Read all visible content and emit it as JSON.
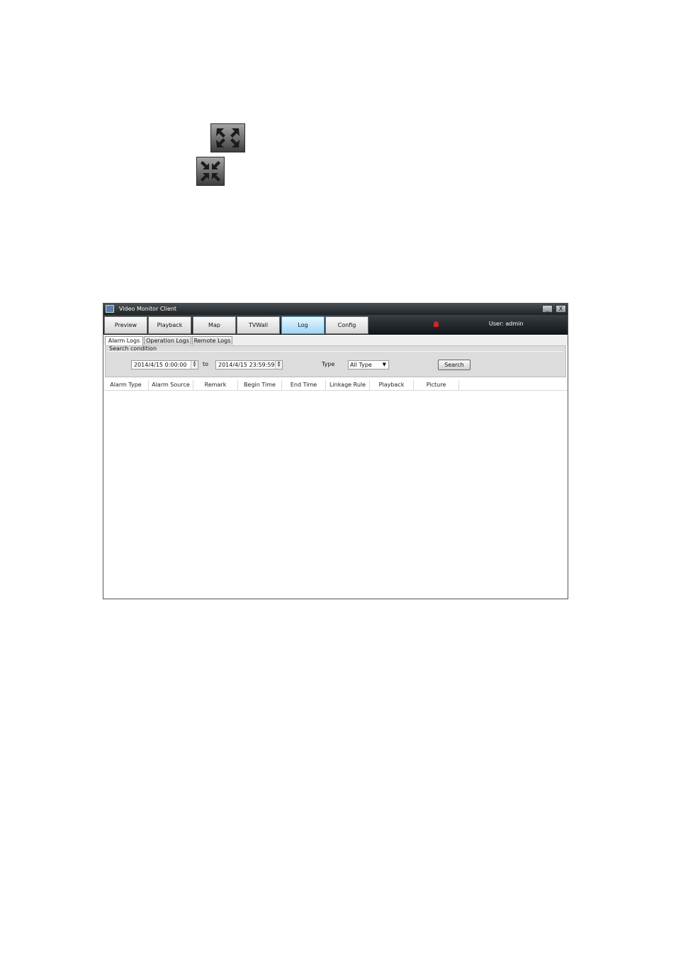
{
  "top_icons": [
    {
      "name": "expand-fullscreen-icon"
    },
    {
      "name": "collapse-fullscreen-icon"
    }
  ],
  "window": {
    "title": "Video Monitor Client",
    "minimize_label": "_",
    "close_label": "X",
    "nav_tabs": [
      "Preview",
      "Playback",
      "Map",
      "TVWall",
      "Log",
      "Config"
    ],
    "active_tab": "Log",
    "user_text": "User: admin",
    "sub_tabs": [
      "Alarm Logs",
      "Operation Logs",
      "Remote Logs"
    ],
    "active_sub_tab": "Alarm Logs",
    "search": {
      "legend": "Search condition",
      "start_time": "2014/4/15 0:00:00",
      "to_label": "to",
      "end_time": "2014/4/15 23:59:59",
      "type_label": "Type",
      "type_value": "All Type",
      "search_button": "Search"
    },
    "columns": [
      "Alarm Type",
      "Alarm Source",
      "Remark",
      "Begin Time",
      "End Time",
      "Linkage Rule",
      "Playback",
      "Picture"
    ],
    "rows": []
  },
  "colors": {
    "nav_active": "#9fd7f5",
    "title_bar": "#1d2225",
    "alarm_indicator": "#d42222"
  }
}
